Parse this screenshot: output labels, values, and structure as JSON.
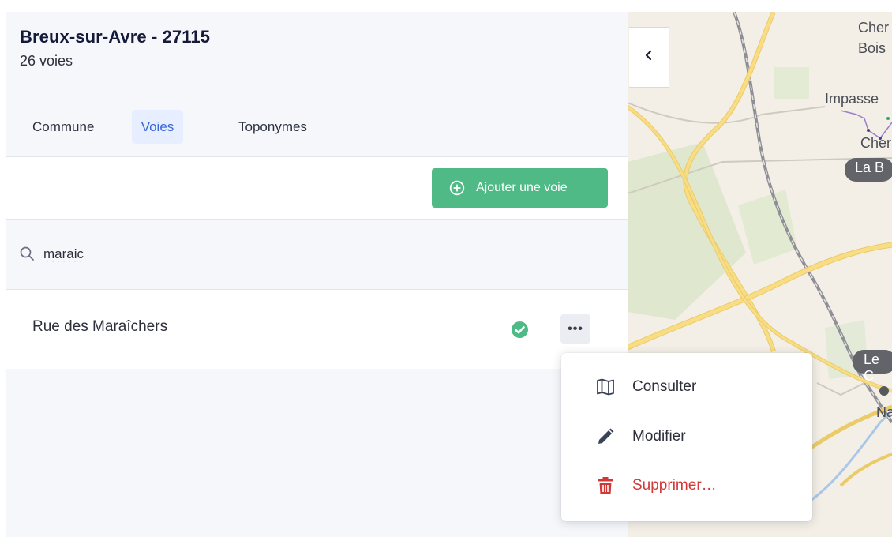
{
  "header": {
    "title": "Breux-sur-Avre - 27115",
    "subtitle": "26 voies"
  },
  "tabs": [
    {
      "label": "Commune"
    },
    {
      "label": "Voies",
      "active": true
    },
    {
      "label": "Toponymes"
    }
  ],
  "toolbar": {
    "add_label": "Ajouter une voie",
    "add_icon": "plus-circle-icon"
  },
  "search": {
    "value": "maraic",
    "icon": "search-icon"
  },
  "rows": [
    {
      "name": "Rue des Maraîchers",
      "status_icon": "check-circle-icon",
      "more_label": "•••"
    }
  ],
  "menu": {
    "items": [
      {
        "label": "Consulter",
        "icon": "map-icon"
      },
      {
        "label": "Modifier",
        "icon": "pencil-icon"
      },
      {
        "label": "Supprimer…",
        "icon": "trash-icon"
      }
    ]
  },
  "map": {
    "labels": [
      "Cher",
      "Bois",
      "Impasse",
      "Cher",
      "La B",
      "Le C",
      "Na"
    ],
    "collapse_icon": "chevron-left-icon"
  },
  "colors": {
    "accent": "#4fba86",
    "tab_active_bg": "#e6eeff",
    "tab_active_text": "#3a67d6",
    "danger": "#d23838",
    "map_bg": "#f3efe6",
    "road": "#f6d36b"
  }
}
